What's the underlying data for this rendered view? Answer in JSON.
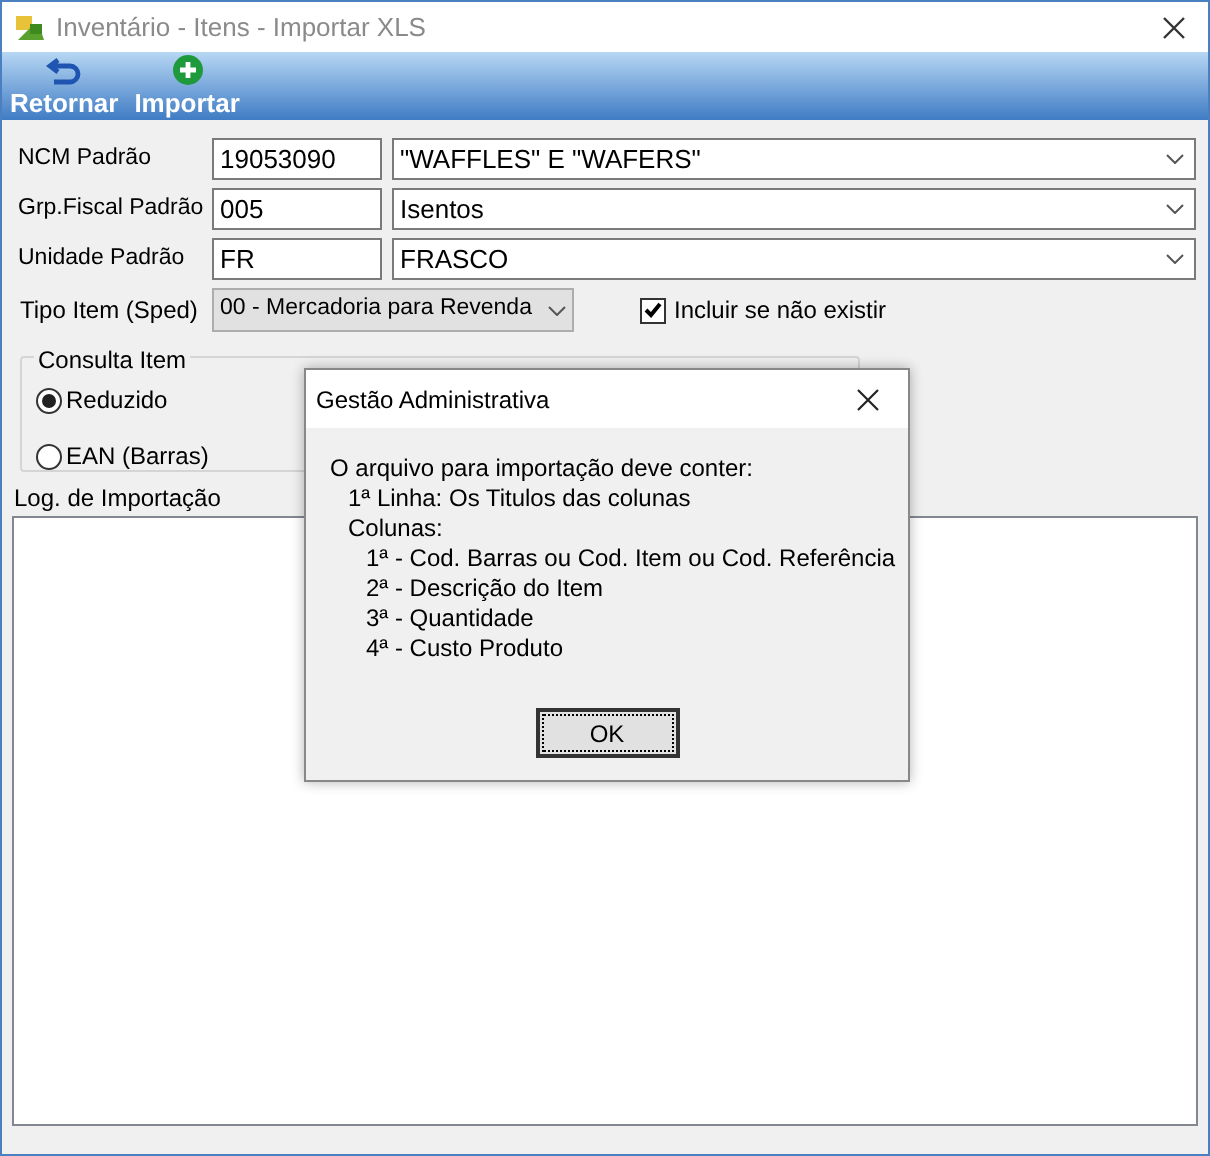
{
  "window": {
    "title": "Inventário - Itens - Importar XLS"
  },
  "toolbar": [
    {
      "label": "Retornar",
      "kind": "back"
    },
    {
      "label": "Importar",
      "kind": "add"
    }
  ],
  "fields": [
    {
      "label": "NCM Padrão",
      "code": "19053090",
      "description": "\"WAFFLES\" E \"WAFERS\""
    },
    {
      "label": "Grp.Fiscal Padrão",
      "code": "005",
      "description": "Isentos"
    },
    {
      "label": "Unidade Padrão",
      "code": "FR",
      "description": "FRASCO"
    }
  ],
  "tipo_item": {
    "label": "Tipo Item (Sped)",
    "value": "00 - Mercadoria para Revenda"
  },
  "include_checkbox": {
    "label": "Incluir se não existir",
    "checked": true
  },
  "consulta_item": {
    "title": "Consulta Item",
    "options": [
      {
        "label": "Reduzido",
        "selected": true
      },
      {
        "label": "EAN (Barras)",
        "selected": false
      }
    ]
  },
  "log": {
    "label": "Log. de Importação"
  },
  "dialog": {
    "title": "Gestão Administrativa",
    "lines": [
      {
        "text": "O arquivo para importação deve conter:",
        "children": [
          {
            "text": "1ª Linha: Os Titulos das colunas"
          },
          {
            "text": "Colunas:",
            "children": [
              {
                "text": "1ª - Cod. Barras ou Cod. Item ou Cod. Referência"
              },
              {
                "text": "2ª - Descrição do Item"
              },
              {
                "text": "3ª - Quantidade"
              },
              {
                "text": "4ª - Custo Produto"
              }
            ]
          }
        ]
      }
    ],
    "button": "OK"
  }
}
